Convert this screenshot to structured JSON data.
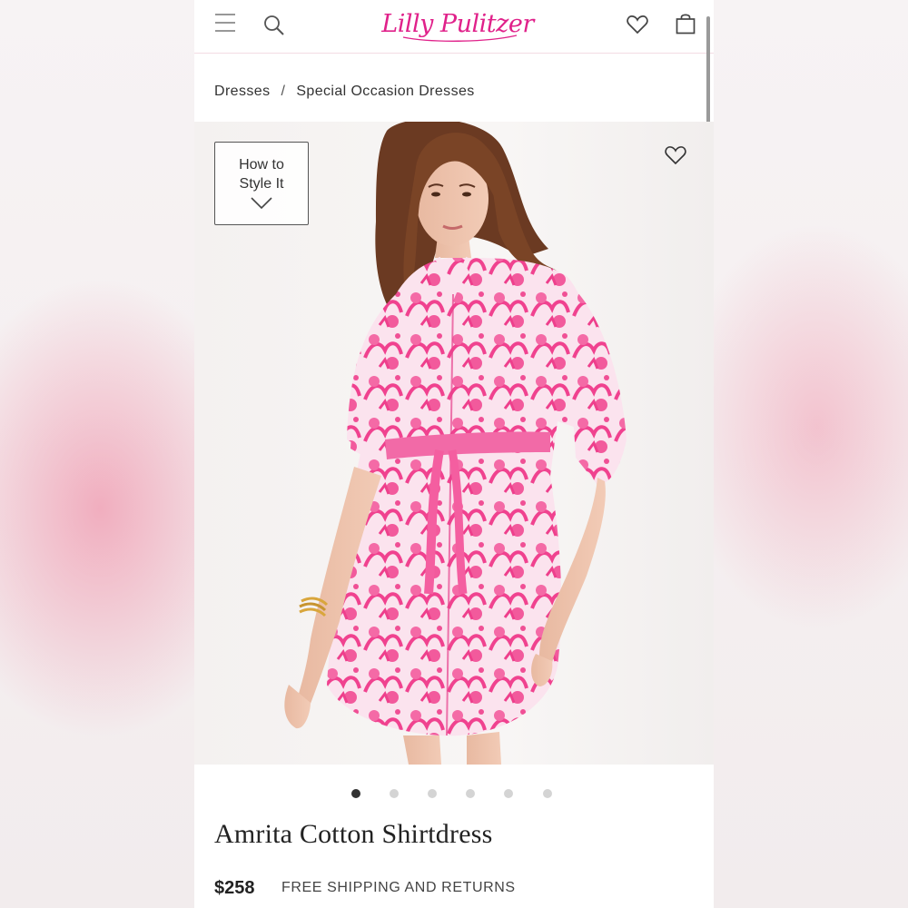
{
  "header": {
    "logo_text": "Lilly Pulitzer",
    "menu_icon": "hamburger-menu-icon",
    "search_icon": "search-icon",
    "wishlist_icon": "heart-icon",
    "bag_icon": "shopping-bag-icon"
  },
  "breadcrumb": {
    "items": [
      "Dresses",
      "Special Occasion Dresses"
    ],
    "separator": "/"
  },
  "gallery": {
    "style_button_line1": "How to",
    "style_button_line2": "Style It",
    "favorite_icon": "heart-outline-icon",
    "image_description": "model wearing pink and white print shirtdress with tie belt",
    "slide_count": 6,
    "active_slide": 1
  },
  "product": {
    "title": "Amrita Cotton Shirtdress",
    "price": "$258",
    "shipping_note": "FREE SHIPPING AND RETURNS"
  },
  "colors": {
    "brand_pink": "#e0218a",
    "print_pink": "#f04f95",
    "text_dark": "#222222"
  }
}
